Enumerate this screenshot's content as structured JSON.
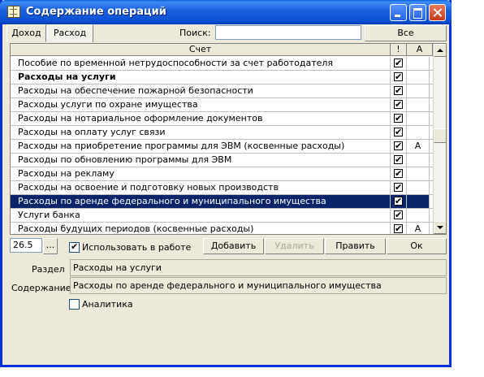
{
  "window": {
    "title": "Содержание операций"
  },
  "tabs": [
    {
      "label": "Доход"
    },
    {
      "label": "Расход"
    }
  ],
  "search": {
    "label": "Поиск:",
    "value": ""
  },
  "all_button": "Все",
  "grid": {
    "columns": [
      {
        "label": "Счет"
      },
      {
        "label": "!"
      },
      {
        "label": "А"
      }
    ],
    "rows": [
      {
        "name": "Пособие по временной нетрудоспособности за счет работодателя",
        "checked": true,
        "a": ""
      },
      {
        "name": "Расходы на услуги",
        "checked": true,
        "a": "",
        "bold": true
      },
      {
        "name": "Расходы на обеспечение пожарной безопасности",
        "checked": true,
        "a": ""
      },
      {
        "name": "Расходы услуги по охране имущества",
        "checked": true,
        "a": ""
      },
      {
        "name": "Расходы на нотариальное оформление документов",
        "checked": true,
        "a": ""
      },
      {
        "name": "Расходы на оплату услуг связи",
        "checked": true,
        "a": ""
      },
      {
        "name": "Расходы на приобретение программы для ЭВМ (косвенные расходы)",
        "checked": true,
        "a": "А"
      },
      {
        "name": "Расходы по обновлению программы для ЭВМ",
        "checked": true,
        "a": ""
      },
      {
        "name": "Расходы на рекламу",
        "checked": true,
        "a": ""
      },
      {
        "name": "Расходы на освоение и подготовку новых производств",
        "checked": true,
        "a": ""
      },
      {
        "name": "Расходы по аренде федерального и муниципального имущества",
        "checked": true,
        "a": "",
        "selected": true
      },
      {
        "name": "Услуги банка",
        "checked": true,
        "a": ""
      },
      {
        "name": "Расходы будущих периодов (косвенные расходы)",
        "checked": true,
        "a": "А"
      }
    ]
  },
  "toolbar": {
    "code": "26.5",
    "ellipsis": "...",
    "use_in_work": {
      "label": "Использовать в работе",
      "checked": true
    },
    "add": "Добавить",
    "delete": "Удалить",
    "edit": "Править",
    "ok": "Ок"
  },
  "details": {
    "section_label": "Раздел",
    "section_value": "Расходы на услуги",
    "content_label": "Содержание",
    "content_value": "Расходы по аренде федерального и муниципального имущества"
  },
  "analytics": {
    "label": "Аналитика",
    "checked": false
  }
}
